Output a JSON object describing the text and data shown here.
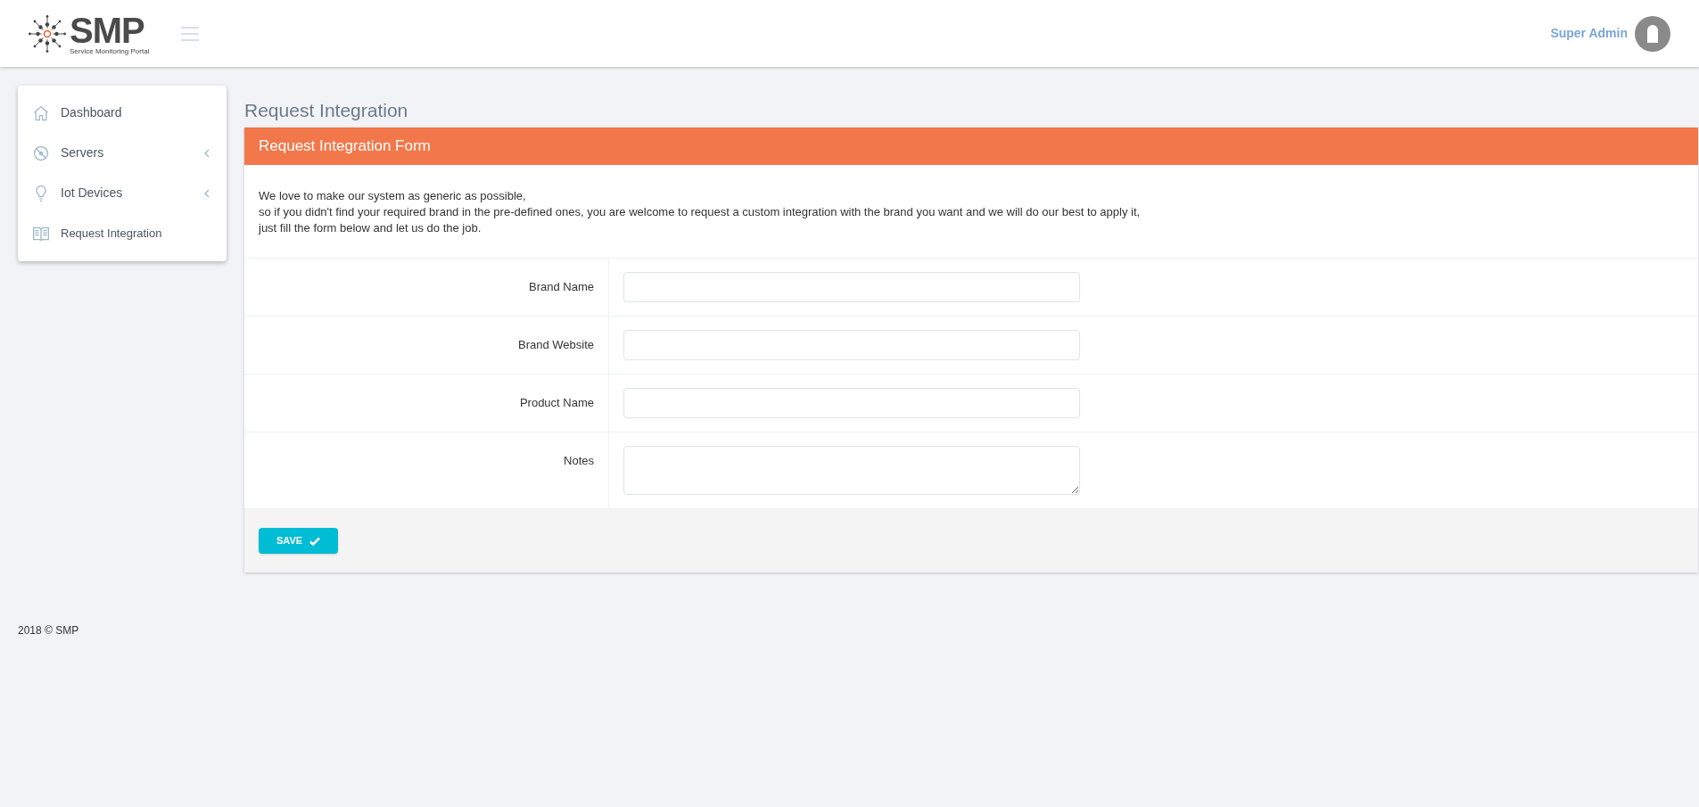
{
  "header": {
    "logo_text": "SMP",
    "logo_subtitle": "Service Monitoring Portal",
    "user_name": "Super Admin"
  },
  "sidebar": {
    "items": [
      {
        "label": "Dashboard",
        "kind": "home",
        "expandable": false
      },
      {
        "label": "Servers",
        "kind": "server",
        "expandable": true
      },
      {
        "label": "Iot Devices",
        "kind": "bulb",
        "expandable": true
      },
      {
        "label": "Request Integration",
        "kind": "book",
        "expandable": false
      }
    ]
  },
  "page_title": "Request Integration",
  "form": {
    "title": "Request Integration Form",
    "intro": [
      "We love to make our system as generic as possible,",
      "so if you didn't find your required brand in the pre-defined ones, you are welcome to request a custom integration with the brand you want and we will do our best to apply it,",
      "just fill the form below and let us do the job."
    ],
    "fields": [
      {
        "label": "Brand Name",
        "kind": "input"
      },
      {
        "label": "Brand Website",
        "kind": "input"
      },
      {
        "label": "Product Name",
        "kind": "input"
      },
      {
        "label": "Notes",
        "kind": "textarea"
      }
    ],
    "save_button": "SAVE"
  },
  "footer": "2018 © SMP"
}
